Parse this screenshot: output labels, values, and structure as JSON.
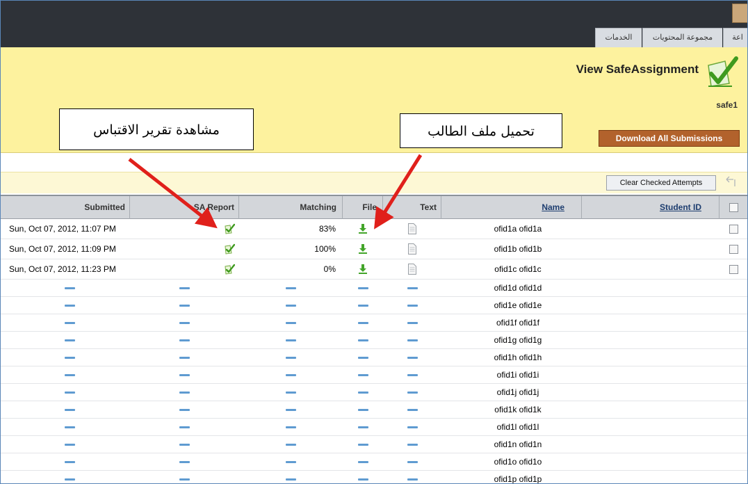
{
  "nav": {
    "tabs": [
      {
        "label": "الخدمات"
      },
      {
        "label": "مجموعة المحتويات"
      },
      {
        "label": "اعة"
      }
    ]
  },
  "header": {
    "title": "View SafeAssignment",
    "subtitle": "safe1",
    "download_all_label": "Download All Submissions"
  },
  "annotations": {
    "report_callout": "مشاهدة تقرير الاقتباس",
    "file_callout": "تحميل ملف الطالب"
  },
  "actions": {
    "clear_label": "Clear Checked Attempts"
  },
  "colors": {
    "accent_dashes": "#5f9bd1",
    "download_button": "#b2622c",
    "callout_arrow": "#e0201b"
  },
  "table": {
    "headers": {
      "submitted": "Submitted",
      "report": "SA Report",
      "matching": "Matching",
      "file": "File",
      "text": "Text",
      "name": "Name",
      "student_id": "Student ID"
    },
    "rows": [
      {
        "submitted": "Sun, Oct 07, 2012, 11:07 PM",
        "matching": "83%",
        "name": "ofid1a ofid1a"
      },
      {
        "submitted": "Sun, Oct 07, 2012, 11:09 PM",
        "matching": "100%",
        "name": "ofid1b ofid1b"
      },
      {
        "submitted": "Sun, Oct 07, 2012, 11:23 PM",
        "matching": "0%",
        "name": "ofid1c ofid1c"
      }
    ],
    "empty_rows": [
      {
        "name": "ofid1d ofid1d"
      },
      {
        "name": "ofid1e ofid1e"
      },
      {
        "name": "ofid1f ofid1f"
      },
      {
        "name": "ofid1g ofid1g"
      },
      {
        "name": "ofid1h ofid1h"
      },
      {
        "name": "ofid1i ofid1i"
      },
      {
        "name": "ofid1j ofid1j"
      },
      {
        "name": "ofid1k ofid1k"
      },
      {
        "name": "ofid1l ofid1l"
      },
      {
        "name": "ofid1n ofid1n"
      },
      {
        "name": "ofid1o ofid1o"
      },
      {
        "name": "ofid1p ofid1p"
      }
    ]
  }
}
